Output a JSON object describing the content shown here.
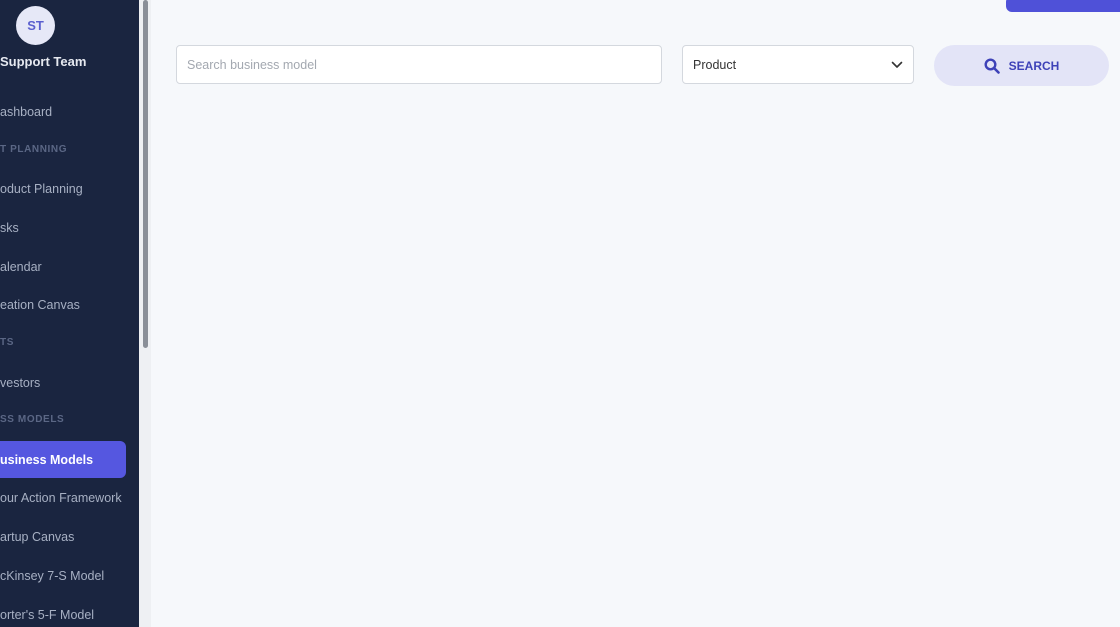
{
  "sidebar": {
    "avatar_initials": "ST",
    "team_name": "Support Team",
    "items": [
      {
        "label": "ashboard"
      },
      {
        "label": "T PLANNING"
      },
      {
        "label": "oduct Planning"
      },
      {
        "label": "sks"
      },
      {
        "label": "alendar"
      },
      {
        "label": "eation Canvas"
      },
      {
        "label": "TS"
      },
      {
        "label": "vestors"
      },
      {
        "label": "SS MODELS"
      },
      {
        "label": "usiness Models"
      },
      {
        "label": "our Action Framework"
      },
      {
        "label": "artup Canvas"
      },
      {
        "label": "cKinsey 7-S Model"
      },
      {
        "label": "orter's 5-F Model"
      }
    ]
  },
  "search": {
    "placeholder": "Search business model",
    "value": ""
  },
  "filter": {
    "selected": "Product"
  },
  "search_button": {
    "label": "SEARCH"
  },
  "colors": {
    "sidebar_bg": "#1a2540",
    "accent": "#5557e0",
    "page_bg": "#f6f8fb"
  }
}
